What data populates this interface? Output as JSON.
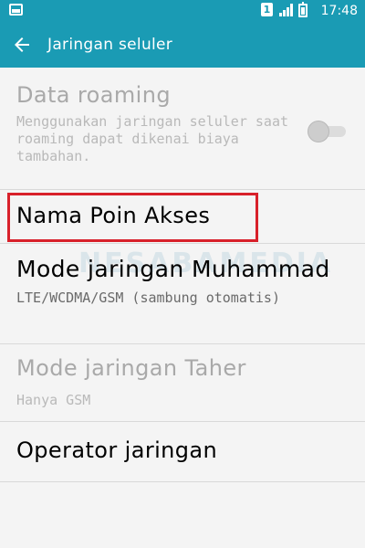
{
  "status_bar": {
    "sim_slot": "1",
    "time": "17:48",
    "icons": [
      "gallery-icon",
      "sim-icon",
      "signal-icon",
      "battery-icon"
    ]
  },
  "app_bar": {
    "title": "Jaringan seluler",
    "back_icon": "arrow-left-icon"
  },
  "settings": {
    "data_roaming": {
      "title": "Data roaming",
      "summary": "Menggunakan jaringan seluler saat roaming dapat dikenai biaya tambahan.",
      "enabled": false,
      "toggle_on": false
    },
    "apn": {
      "title": "Nama Poin Akses"
    },
    "network_mode_1": {
      "title": "Mode jaringan Muhammad",
      "summary": "LTE/WCDMA/GSM (sambung otomatis)"
    },
    "network_mode_2": {
      "title": "Mode jaringan Taher",
      "summary": "Hanya GSM",
      "enabled": false
    },
    "operator": {
      "title": "Operator jaringan"
    }
  },
  "watermark": "NESABAMEDIA",
  "colors": {
    "primary": "#1a9bb4",
    "highlight": "#d8202a",
    "disabled_text": "#a9a9a9"
  }
}
